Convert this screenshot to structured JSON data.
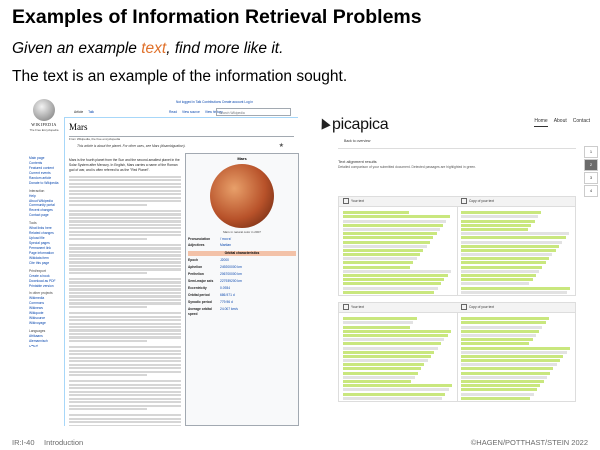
{
  "slide": {
    "title": "Examples of Information Retrieval Problems",
    "subtitle_pre": "Given an example ",
    "subtitle_highlight": "text",
    "subtitle_post": ", find more like it.",
    "statement": "The text is an example of the information sought.",
    "highlight_color": "#e0712b"
  },
  "footer": {
    "page": "IR:I-40",
    "section": "Introduction",
    "copyright": "©HAGEN/POTTHAST/STEIN 2022"
  },
  "wikipedia": {
    "brand": "WIKIPEDIA",
    "brand_sub": "The Free Encyclopedia",
    "top_links": "Not logged in  Talk  Contributions  Create account  Log in",
    "tabs": [
      "Article",
      "Talk",
      "Read",
      "View source",
      "View history"
    ],
    "search_placeholder": "Search Wikipedia",
    "nav": [
      {
        "label": "Main page"
      },
      {
        "label": "Contents"
      },
      {
        "label": "Featured content"
      },
      {
        "label": "Current events"
      },
      {
        "label": "Random article"
      },
      {
        "label": "Donate to Wikipedia"
      },
      {
        "label": "Interaction",
        "heading": true
      },
      {
        "label": "Help"
      },
      {
        "label": "About Wikipedia"
      },
      {
        "label": "Community portal"
      },
      {
        "label": "Recent changes"
      },
      {
        "label": "Contact page"
      },
      {
        "label": "Tools",
        "heading": true
      },
      {
        "label": "What links here"
      },
      {
        "label": "Related changes"
      },
      {
        "label": "Upload file"
      },
      {
        "label": "Special pages"
      },
      {
        "label": "Permanent link"
      },
      {
        "label": "Page information"
      },
      {
        "label": "Wikidata item"
      },
      {
        "label": "Cite this page"
      },
      {
        "label": "Print/export",
        "heading": true
      },
      {
        "label": "Create a book"
      },
      {
        "label": "Download as PDF"
      },
      {
        "label": "Printable version"
      },
      {
        "label": "In other projects",
        "heading": true
      },
      {
        "label": "Wikimedia Commons"
      },
      {
        "label": "Wikinews"
      },
      {
        "label": "Wikiquote"
      },
      {
        "label": "Wikisource"
      },
      {
        "label": "Wikivoyage"
      },
      {
        "label": "Languages",
        "heading": true
      },
      {
        "label": "Afrikaans"
      },
      {
        "label": "Alemannisch"
      },
      {
        "label": "አማርኛ"
      }
    ],
    "article_title": "Mars",
    "tagline": "From Wikipedia, the free encyclopedia",
    "hatnote": "This article is about the planet. For other uses, see Mars (disambiguation).",
    "lead": "Mars is the fourth planet from the Sun and the second-smallest planet in the Solar System after Mercury. In English, Mars carries a name of the Roman god of war, and is often referred to as the \"Red Planet\".",
    "infobox": {
      "title": "Mars",
      "caption": "Mars in natural color in 2007",
      "rows": [
        {
          "k": "Pronunciation",
          "v": "/ˈmɑːrz/"
        },
        {
          "k": "Adjectives",
          "v": "Martian"
        },
        {
          "k": "Orbital characteristics",
          "v": ""
        },
        {
          "k": "Epoch",
          "v": "J2000"
        },
        {
          "k": "Aphelion",
          "v": "249200000 km"
        },
        {
          "k": "Perihelion",
          "v": "206700000 km"
        },
        {
          "k": "Semi-major axis",
          "v": "227939200 km"
        },
        {
          "k": "Eccentricity",
          "v": "0.0934"
        },
        {
          "k": "Orbital period",
          "v": "686.971 d"
        },
        {
          "k": "Synodic period",
          "v": "779.96 d"
        },
        {
          "k": "Average orbital speed",
          "v": "24.007 km/s"
        }
      ]
    }
  },
  "picapica": {
    "brand": "picapica",
    "menu": [
      "Home",
      "About",
      "Contact"
    ],
    "back_label": "Back to overview",
    "summary_title": "Text alignment results",
    "summary_desc": "Detailed comparison of your submitted document. Detected passages are highlighted in green.",
    "pairs": [
      {
        "left_header": "Your text",
        "right_header": "Copy of your text"
      },
      {
        "left_header": "Your text",
        "right_header": "Copy of your text"
      }
    ],
    "side": [
      "1",
      "2",
      "3",
      "4"
    ],
    "highlight_color": "#c9e77e"
  }
}
